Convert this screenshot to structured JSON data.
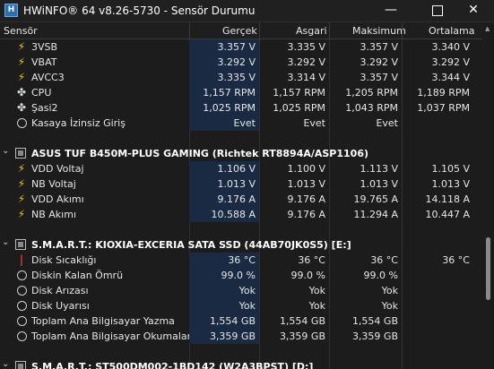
{
  "window": {
    "title": "HWiNFO® 64 v8.26-5730 - Sensör Durumu",
    "app_icon_text": "H"
  },
  "columns": {
    "sensor": "Sensör",
    "current": "Gerçek",
    "min": "Asgari",
    "max": "Maksimum",
    "avg": "Ortalama"
  },
  "rows": [
    {
      "type": "sensor",
      "icon": "bolt-icon",
      "glyph": "⚡",
      "label": "3VSB",
      "cur": "3.357 V",
      "min": "3.335 V",
      "max": "3.357 V",
      "avg": "3.340 V"
    },
    {
      "type": "sensor",
      "icon": "bolt-icon",
      "glyph": "⚡",
      "label": "VBAT",
      "cur": "3.292 V",
      "min": "3.292 V",
      "max": "3.292 V",
      "avg": "3.292 V"
    },
    {
      "type": "sensor",
      "icon": "bolt-icon",
      "glyph": "⚡",
      "label": "AVCC3",
      "cur": "3.335 V",
      "min": "3.314 V",
      "max": "3.357 V",
      "avg": "3.344 V"
    },
    {
      "type": "sensor",
      "icon": "fan-icon",
      "glyph": "✤",
      "label": "CPU",
      "cur": "1,157 RPM",
      "min": "1,157 RPM",
      "max": "1,205 RPM",
      "avg": "1,189 RPM"
    },
    {
      "type": "sensor",
      "icon": "fan-icon",
      "glyph": "✤",
      "label": "Şasi2",
      "cur": "1,025 RPM",
      "min": "1,025 RPM",
      "max": "1,043 RPM",
      "avg": "1,037 RPM"
    },
    {
      "type": "sensor",
      "icon": "status-circle-icon",
      "glyph": "",
      "label": "Kasaya İzinsiz Giriş",
      "cur": "Evet",
      "min": "Evet",
      "max": "Evet",
      "avg": ""
    },
    {
      "type": "spacer"
    },
    {
      "type": "group",
      "label": "ASUS TUF B450M-PLUS GAMING (Richtek RT8894A/ASP1106)"
    },
    {
      "type": "sensor",
      "icon": "bolt-icon",
      "glyph": "⚡",
      "label": "VDD Voltaj",
      "cur": "1.106 V",
      "min": "1.100 V",
      "max": "1.113 V",
      "avg": "1.105 V"
    },
    {
      "type": "sensor",
      "icon": "bolt-icon",
      "glyph": "⚡",
      "label": "NB Voltaj",
      "cur": "1.013 V",
      "min": "1.013 V",
      "max": "1.013 V",
      "avg": "1.013 V"
    },
    {
      "type": "sensor",
      "icon": "bolt-icon",
      "glyph": "⚡",
      "label": "VDD Akımı",
      "cur": "9.176 A",
      "min": "9.176 A",
      "max": "19.765 A",
      "avg": "14.118 A"
    },
    {
      "type": "sensor",
      "icon": "bolt-icon",
      "glyph": "⚡",
      "label": "NB Akımı",
      "cur": "10.588 A",
      "min": "9.176 A",
      "max": "11.294 A",
      "avg": "10.447 A"
    },
    {
      "type": "spacer"
    },
    {
      "type": "group",
      "label": "S.M.A.R.T.: KIOXIA-EXCERIA SATA SSD (44AB70JK0S5) [E:]"
    },
    {
      "type": "sensor",
      "icon": "thermometer-icon",
      "glyph": "🌡",
      "label": "Disk Sıcaklığı",
      "cur": "36 °C",
      "min": "36 °C",
      "max": "36 °C",
      "avg": "36 °C"
    },
    {
      "type": "sensor",
      "icon": "status-circle-icon",
      "glyph": "",
      "label": "Diskin Kalan Ömrü",
      "cur": "99.0 %",
      "min": "99.0 %",
      "max": "99.0 %",
      "avg": ""
    },
    {
      "type": "sensor",
      "icon": "status-circle-icon",
      "glyph": "",
      "label": "Disk Arızası",
      "cur": "Yok",
      "min": "Yok",
      "max": "Yok",
      "avg": ""
    },
    {
      "type": "sensor",
      "icon": "status-circle-icon",
      "glyph": "",
      "label": "Disk Uyarısı",
      "cur": "Yok",
      "min": "Yok",
      "max": "Yok",
      "avg": ""
    },
    {
      "type": "sensor",
      "icon": "status-circle-icon",
      "glyph": "",
      "label": "Toplam Ana Bilgisayar Yazma",
      "cur": "1,554 GB",
      "min": "1,554 GB",
      "max": "1,554 GB",
      "avg": ""
    },
    {
      "type": "sensor",
      "icon": "status-circle-icon",
      "glyph": "",
      "label": "Toplam Ana Bilgisayar Okumaları",
      "cur": "3,359 GB",
      "min": "3,359 GB",
      "max": "3,359 GB",
      "avg": ""
    },
    {
      "type": "spacer"
    },
    {
      "type": "group",
      "label": "S.M.A.R.T.: ST500DM002-1BD142 (W2A3BPST) [D:]"
    }
  ]
}
